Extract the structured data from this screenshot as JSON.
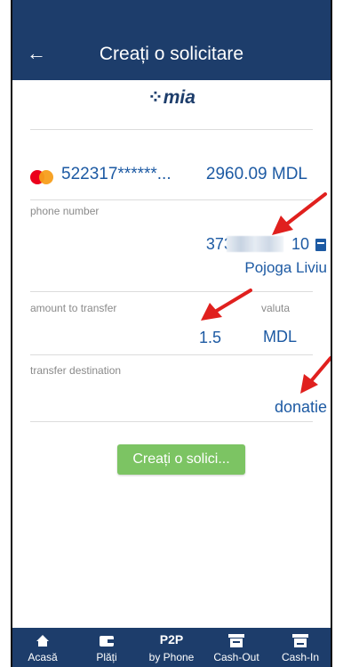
{
  "header": {
    "title": "Creați o solicitare",
    "back_icon": "←"
  },
  "logo_text": "mia",
  "card": {
    "number": "522317******...",
    "balance": "2960.09 MDL"
  },
  "phone": {
    "label": "phone number",
    "value_prefix": "373",
    "value_suffix": "10",
    "contact_name": "Pojoga Liviu"
  },
  "amount": {
    "label": "amount to transfer",
    "value": "1.5"
  },
  "currency": {
    "label": "valuta",
    "value": "MDL"
  },
  "destination": {
    "label": "transfer destination",
    "value": "donatie"
  },
  "submit_button": "Creați o solici...",
  "nav": [
    {
      "icon": "home-icon",
      "label": "Acasă"
    },
    {
      "icon": "wallet-icon",
      "label": "Plăți"
    },
    {
      "icon_text": "P2P",
      "label": "by Phone"
    },
    {
      "icon": "cash-out-icon",
      "label": "Cash-Out"
    },
    {
      "icon": "cash-in-icon",
      "label": "Cash-In"
    }
  ],
  "colors": {
    "header_bg": "#1d3d6b",
    "accent_blue": "#1d5aa3",
    "button_green": "#7cc463",
    "arrow_red": "#e0201e"
  }
}
